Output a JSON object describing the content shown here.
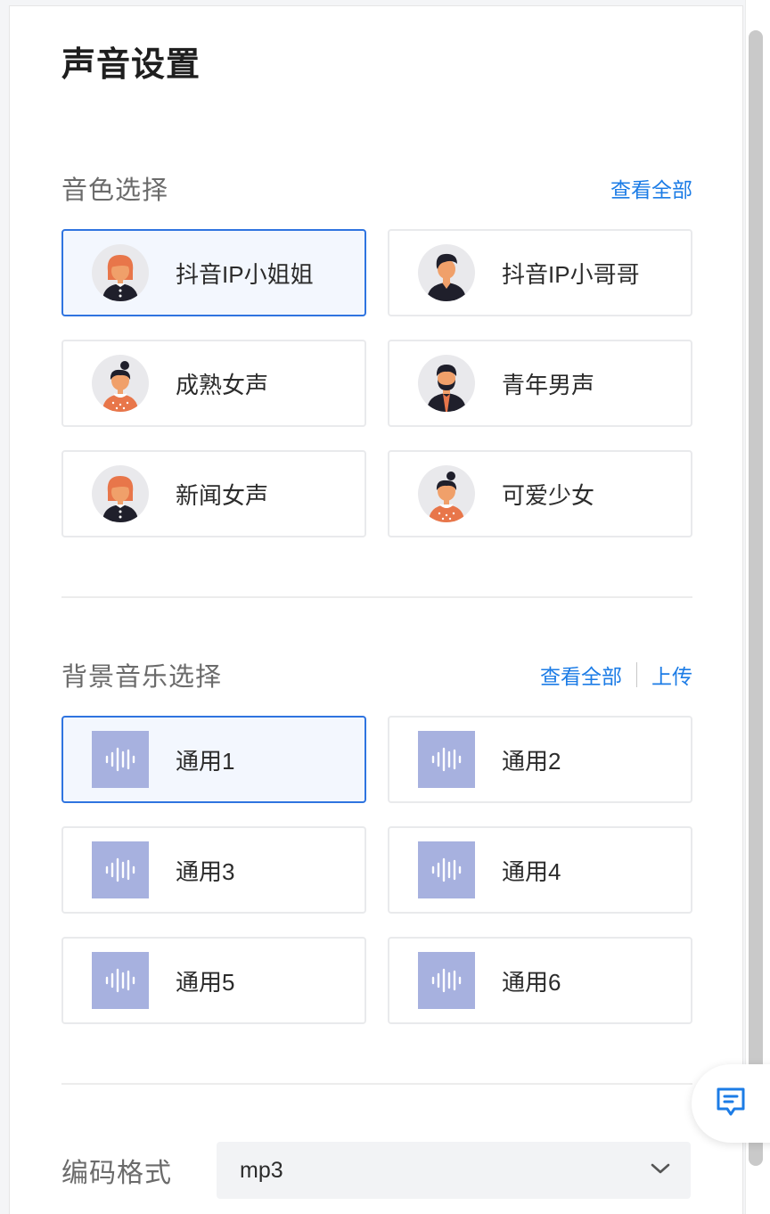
{
  "page": {
    "title": "声音设置"
  },
  "voice_section": {
    "title": "音色选择",
    "view_all": "查看全部",
    "items": [
      {
        "label": "抖音IP小姐姐",
        "avatar": "female-red-hair-avatar",
        "selected": true
      },
      {
        "label": "抖音IP小哥哥",
        "avatar": "male-dark-hair-avatar",
        "selected": false
      },
      {
        "label": "成熟女声",
        "avatar": "female-bun-avatar",
        "selected": false
      },
      {
        "label": "青年男声",
        "avatar": "male-beard-avatar",
        "selected": false
      },
      {
        "label": "新闻女声",
        "avatar": "female-red-hair-avatar",
        "selected": false
      },
      {
        "label": "可爱少女",
        "avatar": "female-bun-avatar",
        "selected": false
      }
    ]
  },
  "music_section": {
    "title": "背景音乐选择",
    "view_all": "查看全部",
    "upload": "上传",
    "items": [
      {
        "label": "通用1",
        "icon": "sound-wave-icon",
        "selected": true
      },
      {
        "label": "通用2",
        "icon": "sound-wave-icon",
        "selected": false
      },
      {
        "label": "通用3",
        "icon": "sound-wave-icon",
        "selected": false
      },
      {
        "label": "通用4",
        "icon": "sound-wave-icon",
        "selected": false
      },
      {
        "label": "通用5",
        "icon": "sound-wave-icon",
        "selected": false
      },
      {
        "label": "通用6",
        "icon": "sound-wave-icon",
        "selected": false
      }
    ]
  },
  "format": {
    "label": "编码格式",
    "value": "mp3"
  },
  "colors": {
    "accent": "#1c7ce6",
    "selected_border": "#2f74e0",
    "selected_bg": "#f3f7fe",
    "music_thumb": "#a7b1df",
    "avatar_skin": "#f0a06a",
    "avatar_hair_red": "#e8764a",
    "avatar_hair_dark": "#1f1f2b"
  }
}
